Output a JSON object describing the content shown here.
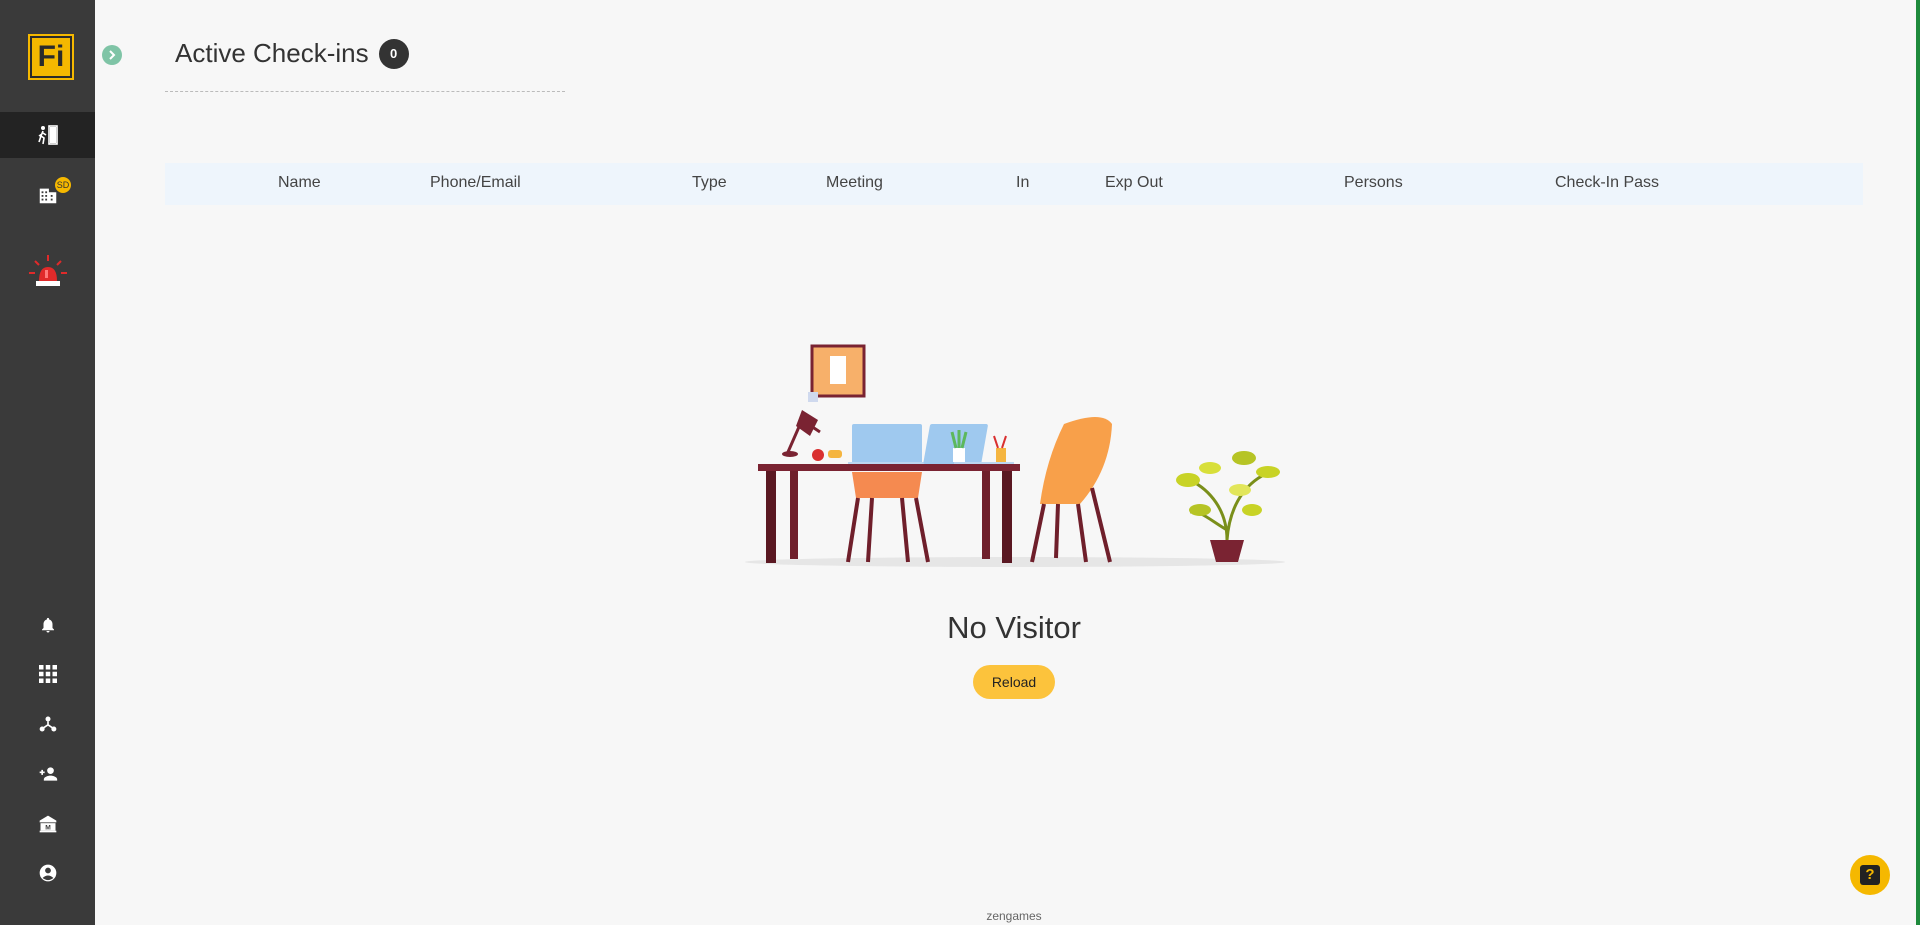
{
  "sidebar": {
    "logo_text": "Fi",
    "badge_sd": "SD",
    "items": [
      {
        "name": "check-in-icon",
        "active": true
      },
      {
        "name": "building-icon",
        "active": false
      },
      {
        "name": "emergency-alarm-icon",
        "active": false
      },
      {
        "name": "bell-icon",
        "active": false
      },
      {
        "name": "grid-icon",
        "active": false
      },
      {
        "name": "network-icon",
        "active": false
      },
      {
        "name": "add-person-icon",
        "active": false
      },
      {
        "name": "institution-icon",
        "active": false
      },
      {
        "name": "account-icon",
        "active": false
      }
    ]
  },
  "header": {
    "title": "Active Check-ins",
    "count": "0"
  },
  "table": {
    "columns": [
      "Name",
      "Phone/Email",
      "Type",
      "Meeting",
      "In",
      "Exp Out",
      "Persons",
      "Check-In Pass"
    ]
  },
  "empty_state": {
    "title": "No Visitor",
    "reload_label": "Reload"
  },
  "footer": {
    "text": "zengames"
  },
  "help": {
    "label": "?"
  },
  "colors": {
    "sidebar_bg": "#3a3a3a",
    "accent": "#f5b800",
    "reload_bg": "#fcc33c",
    "header_row_bg": "#eef5fc"
  }
}
